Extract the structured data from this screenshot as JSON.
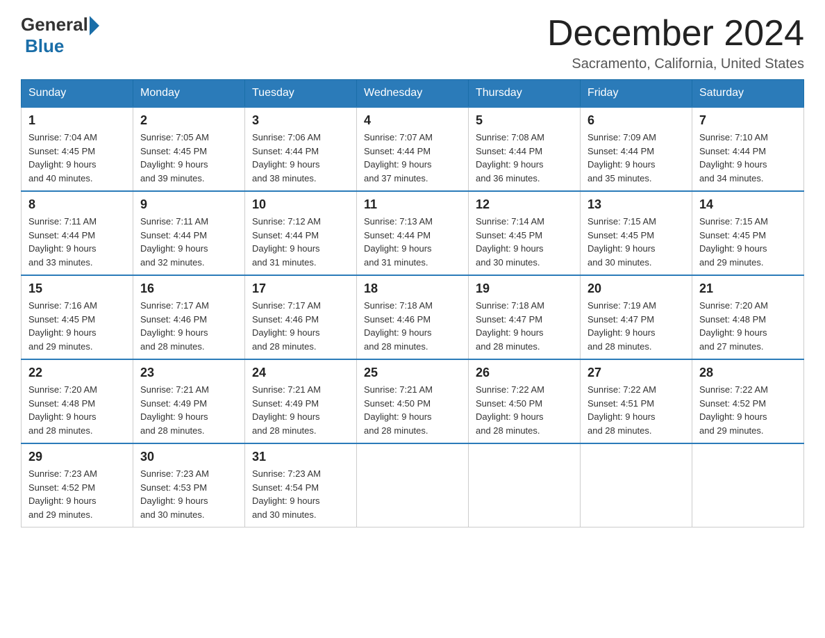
{
  "logo": {
    "text_general": "General",
    "text_blue": "Blue"
  },
  "title": "December 2024",
  "subtitle": "Sacramento, California, United States",
  "days_of_week": [
    "Sunday",
    "Monday",
    "Tuesday",
    "Wednesday",
    "Thursday",
    "Friday",
    "Saturday"
  ],
  "weeks": [
    [
      {
        "day": "1",
        "sunrise": "7:04 AM",
        "sunset": "4:45 PM",
        "daylight": "9 hours and 40 minutes."
      },
      {
        "day": "2",
        "sunrise": "7:05 AM",
        "sunset": "4:45 PM",
        "daylight": "9 hours and 39 minutes."
      },
      {
        "day": "3",
        "sunrise": "7:06 AM",
        "sunset": "4:44 PM",
        "daylight": "9 hours and 38 minutes."
      },
      {
        "day": "4",
        "sunrise": "7:07 AM",
        "sunset": "4:44 PM",
        "daylight": "9 hours and 37 minutes."
      },
      {
        "day": "5",
        "sunrise": "7:08 AM",
        "sunset": "4:44 PM",
        "daylight": "9 hours and 36 minutes."
      },
      {
        "day": "6",
        "sunrise": "7:09 AM",
        "sunset": "4:44 PM",
        "daylight": "9 hours and 35 minutes."
      },
      {
        "day": "7",
        "sunrise": "7:10 AM",
        "sunset": "4:44 PM",
        "daylight": "9 hours and 34 minutes."
      }
    ],
    [
      {
        "day": "8",
        "sunrise": "7:11 AM",
        "sunset": "4:44 PM",
        "daylight": "9 hours and 33 minutes."
      },
      {
        "day": "9",
        "sunrise": "7:11 AM",
        "sunset": "4:44 PM",
        "daylight": "9 hours and 32 minutes."
      },
      {
        "day": "10",
        "sunrise": "7:12 AM",
        "sunset": "4:44 PM",
        "daylight": "9 hours and 31 minutes."
      },
      {
        "day": "11",
        "sunrise": "7:13 AM",
        "sunset": "4:44 PM",
        "daylight": "9 hours and 31 minutes."
      },
      {
        "day": "12",
        "sunrise": "7:14 AM",
        "sunset": "4:45 PM",
        "daylight": "9 hours and 30 minutes."
      },
      {
        "day": "13",
        "sunrise": "7:15 AM",
        "sunset": "4:45 PM",
        "daylight": "9 hours and 30 minutes."
      },
      {
        "day": "14",
        "sunrise": "7:15 AM",
        "sunset": "4:45 PM",
        "daylight": "9 hours and 29 minutes."
      }
    ],
    [
      {
        "day": "15",
        "sunrise": "7:16 AM",
        "sunset": "4:45 PM",
        "daylight": "9 hours and 29 minutes."
      },
      {
        "day": "16",
        "sunrise": "7:17 AM",
        "sunset": "4:46 PM",
        "daylight": "9 hours and 28 minutes."
      },
      {
        "day": "17",
        "sunrise": "7:17 AM",
        "sunset": "4:46 PM",
        "daylight": "9 hours and 28 minutes."
      },
      {
        "day": "18",
        "sunrise": "7:18 AM",
        "sunset": "4:46 PM",
        "daylight": "9 hours and 28 minutes."
      },
      {
        "day": "19",
        "sunrise": "7:18 AM",
        "sunset": "4:47 PM",
        "daylight": "9 hours and 28 minutes."
      },
      {
        "day": "20",
        "sunrise": "7:19 AM",
        "sunset": "4:47 PM",
        "daylight": "9 hours and 28 minutes."
      },
      {
        "day": "21",
        "sunrise": "7:20 AM",
        "sunset": "4:48 PM",
        "daylight": "9 hours and 27 minutes."
      }
    ],
    [
      {
        "day": "22",
        "sunrise": "7:20 AM",
        "sunset": "4:48 PM",
        "daylight": "9 hours and 28 minutes."
      },
      {
        "day": "23",
        "sunrise": "7:21 AM",
        "sunset": "4:49 PM",
        "daylight": "9 hours and 28 minutes."
      },
      {
        "day": "24",
        "sunrise": "7:21 AM",
        "sunset": "4:49 PM",
        "daylight": "9 hours and 28 minutes."
      },
      {
        "day": "25",
        "sunrise": "7:21 AM",
        "sunset": "4:50 PM",
        "daylight": "9 hours and 28 minutes."
      },
      {
        "day": "26",
        "sunrise": "7:22 AM",
        "sunset": "4:50 PM",
        "daylight": "9 hours and 28 minutes."
      },
      {
        "day": "27",
        "sunrise": "7:22 AM",
        "sunset": "4:51 PM",
        "daylight": "9 hours and 28 minutes."
      },
      {
        "day": "28",
        "sunrise": "7:22 AM",
        "sunset": "4:52 PM",
        "daylight": "9 hours and 29 minutes."
      }
    ],
    [
      {
        "day": "29",
        "sunrise": "7:23 AM",
        "sunset": "4:52 PM",
        "daylight": "9 hours and 29 minutes."
      },
      {
        "day": "30",
        "sunrise": "7:23 AM",
        "sunset": "4:53 PM",
        "daylight": "9 hours and 30 minutes."
      },
      {
        "day": "31",
        "sunrise": "7:23 AM",
        "sunset": "4:54 PM",
        "daylight": "9 hours and 30 minutes."
      },
      null,
      null,
      null,
      null
    ]
  ],
  "labels": {
    "sunrise": "Sunrise:",
    "sunset": "Sunset:",
    "daylight": "Daylight:"
  }
}
